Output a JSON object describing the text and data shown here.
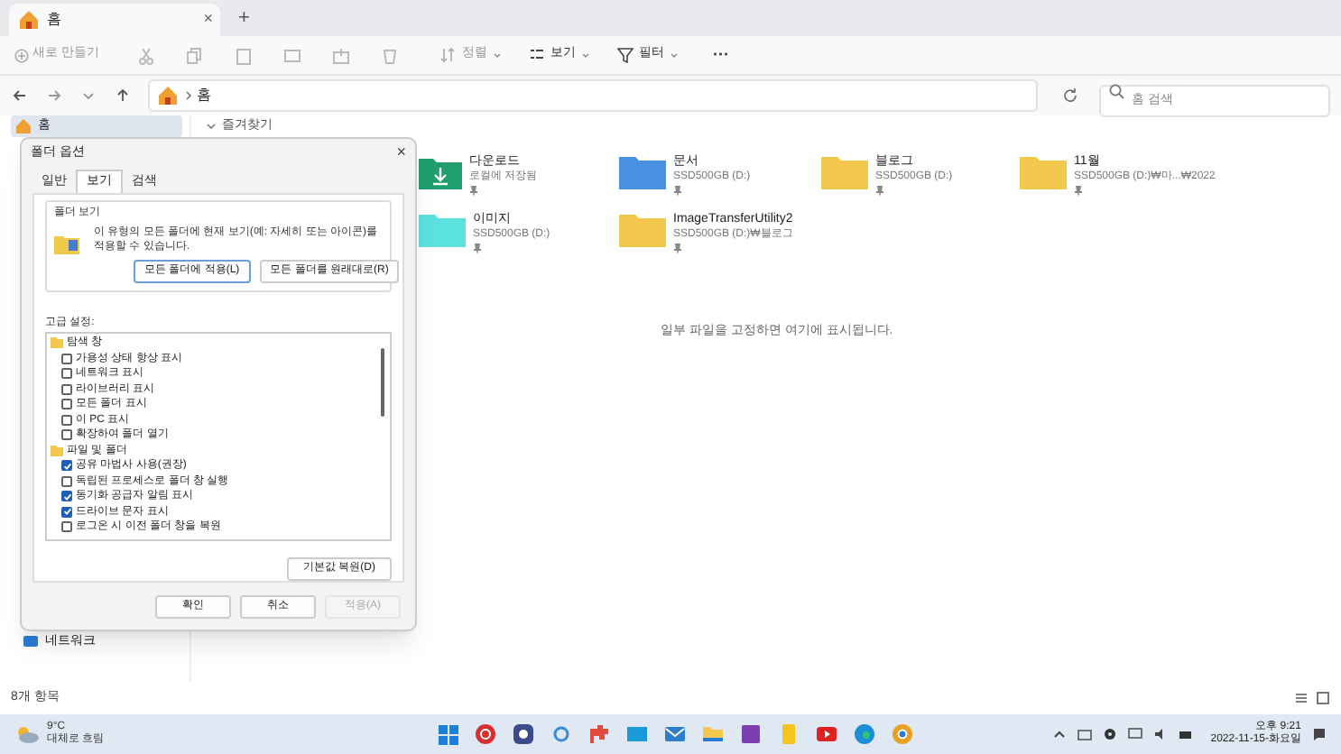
{
  "window": {
    "tab": "홈",
    "new_tab": "+",
    "close": "×"
  },
  "toolbar": {
    "new": "새로 만들기",
    "sort": "정렬",
    "view": "보기",
    "filter": "필터",
    "more": "···"
  },
  "address": {
    "path": "홈",
    "search_placeholder": "홈 검색"
  },
  "sidebar": {
    "items": [
      {
        "label": "홈",
        "kind": "home",
        "selected": true
      },
      {
        "label": "네트워크",
        "kind": "network",
        "selected": false
      }
    ]
  },
  "content": {
    "section": "즐겨찾기",
    "items": [
      {
        "name": "다운로드",
        "location": "로컬에 저장됨",
        "kind": "download",
        "color": "#1f9e6e"
      },
      {
        "name": "문서",
        "location": "SSD500GB (D:)",
        "kind": "folder",
        "color": "#4a90e2"
      },
      {
        "name": "블로그",
        "location": "SSD500GB (D:)",
        "kind": "folder",
        "color": "#f2c94c"
      },
      {
        "name": "11월",
        "location": "SSD500GB (D:)₩마...₩2022",
        "kind": "folder",
        "color": "#f2c94c"
      },
      {
        "name": "이미지",
        "location": "SSD500GB (D:)",
        "kind": "folder",
        "color": "#5ce0e0"
      },
      {
        "name": "ImageTransferUtility2",
        "location": "SSD500GB (D:)₩블로그",
        "kind": "folder",
        "color": "#f2c94c"
      }
    ],
    "empty_message": "일부 파일을 고정하면 여기에 표시됩니다."
  },
  "status_bar": {
    "count": "8개 항목"
  },
  "dialog": {
    "title": "폴더 옵션",
    "close": "×",
    "tabs": [
      {
        "label": "일반",
        "selected": false
      },
      {
        "label": "보기",
        "selected": true
      },
      {
        "label": "검색",
        "selected": false
      }
    ],
    "group_title": "폴더 보기",
    "group_text": "이 유형의 모든 폴더에 현재 보기(예: 자세히 또는 아이콘)를 적용할 수 있습니다.",
    "apply_all": "모든 폴더에 적용(L)",
    "reset_folders": "모든 폴더를 원래대로(R)",
    "advanced_label": "고급 설정:",
    "tree": [
      {
        "label": "탐색 창",
        "children": [
          {
            "label": "가용성 상태 항상 표시",
            "checked": false
          },
          {
            "label": "네트워크 표시",
            "checked": false
          },
          {
            "label": "라이브러리 표시",
            "checked": false
          },
          {
            "label": "모든 폴더 표시",
            "checked": false
          },
          {
            "label": "이 PC 표시",
            "checked": false
          },
          {
            "label": "확장하여 폴더 열기",
            "checked": false
          }
        ]
      },
      {
        "label": "파일 및 폴더",
        "children": [
          {
            "label": "공유 마법사 사용(권장)",
            "checked": true
          },
          {
            "label": "독립된 프로세스로 폴더 창 실행",
            "checked": false
          },
          {
            "label": "동기화 공급자 알림 표시",
            "checked": true
          },
          {
            "label": "드라이브 문자 표시",
            "checked": true
          },
          {
            "label": "로그온 시 이전 폴더 창을 복원",
            "checked": false
          }
        ]
      }
    ],
    "restore": "기본값 복원(D)",
    "buttons": [
      {
        "label": "확인",
        "disabled": false
      },
      {
        "label": "취소",
        "disabled": false
      },
      {
        "label": "적용(A)",
        "disabled": true
      }
    ]
  },
  "taskbar": {
    "temp": "9°C",
    "weather": "대체로 흐림",
    "time": "오후 9:21",
    "date": "2022-11-15-화요일"
  }
}
